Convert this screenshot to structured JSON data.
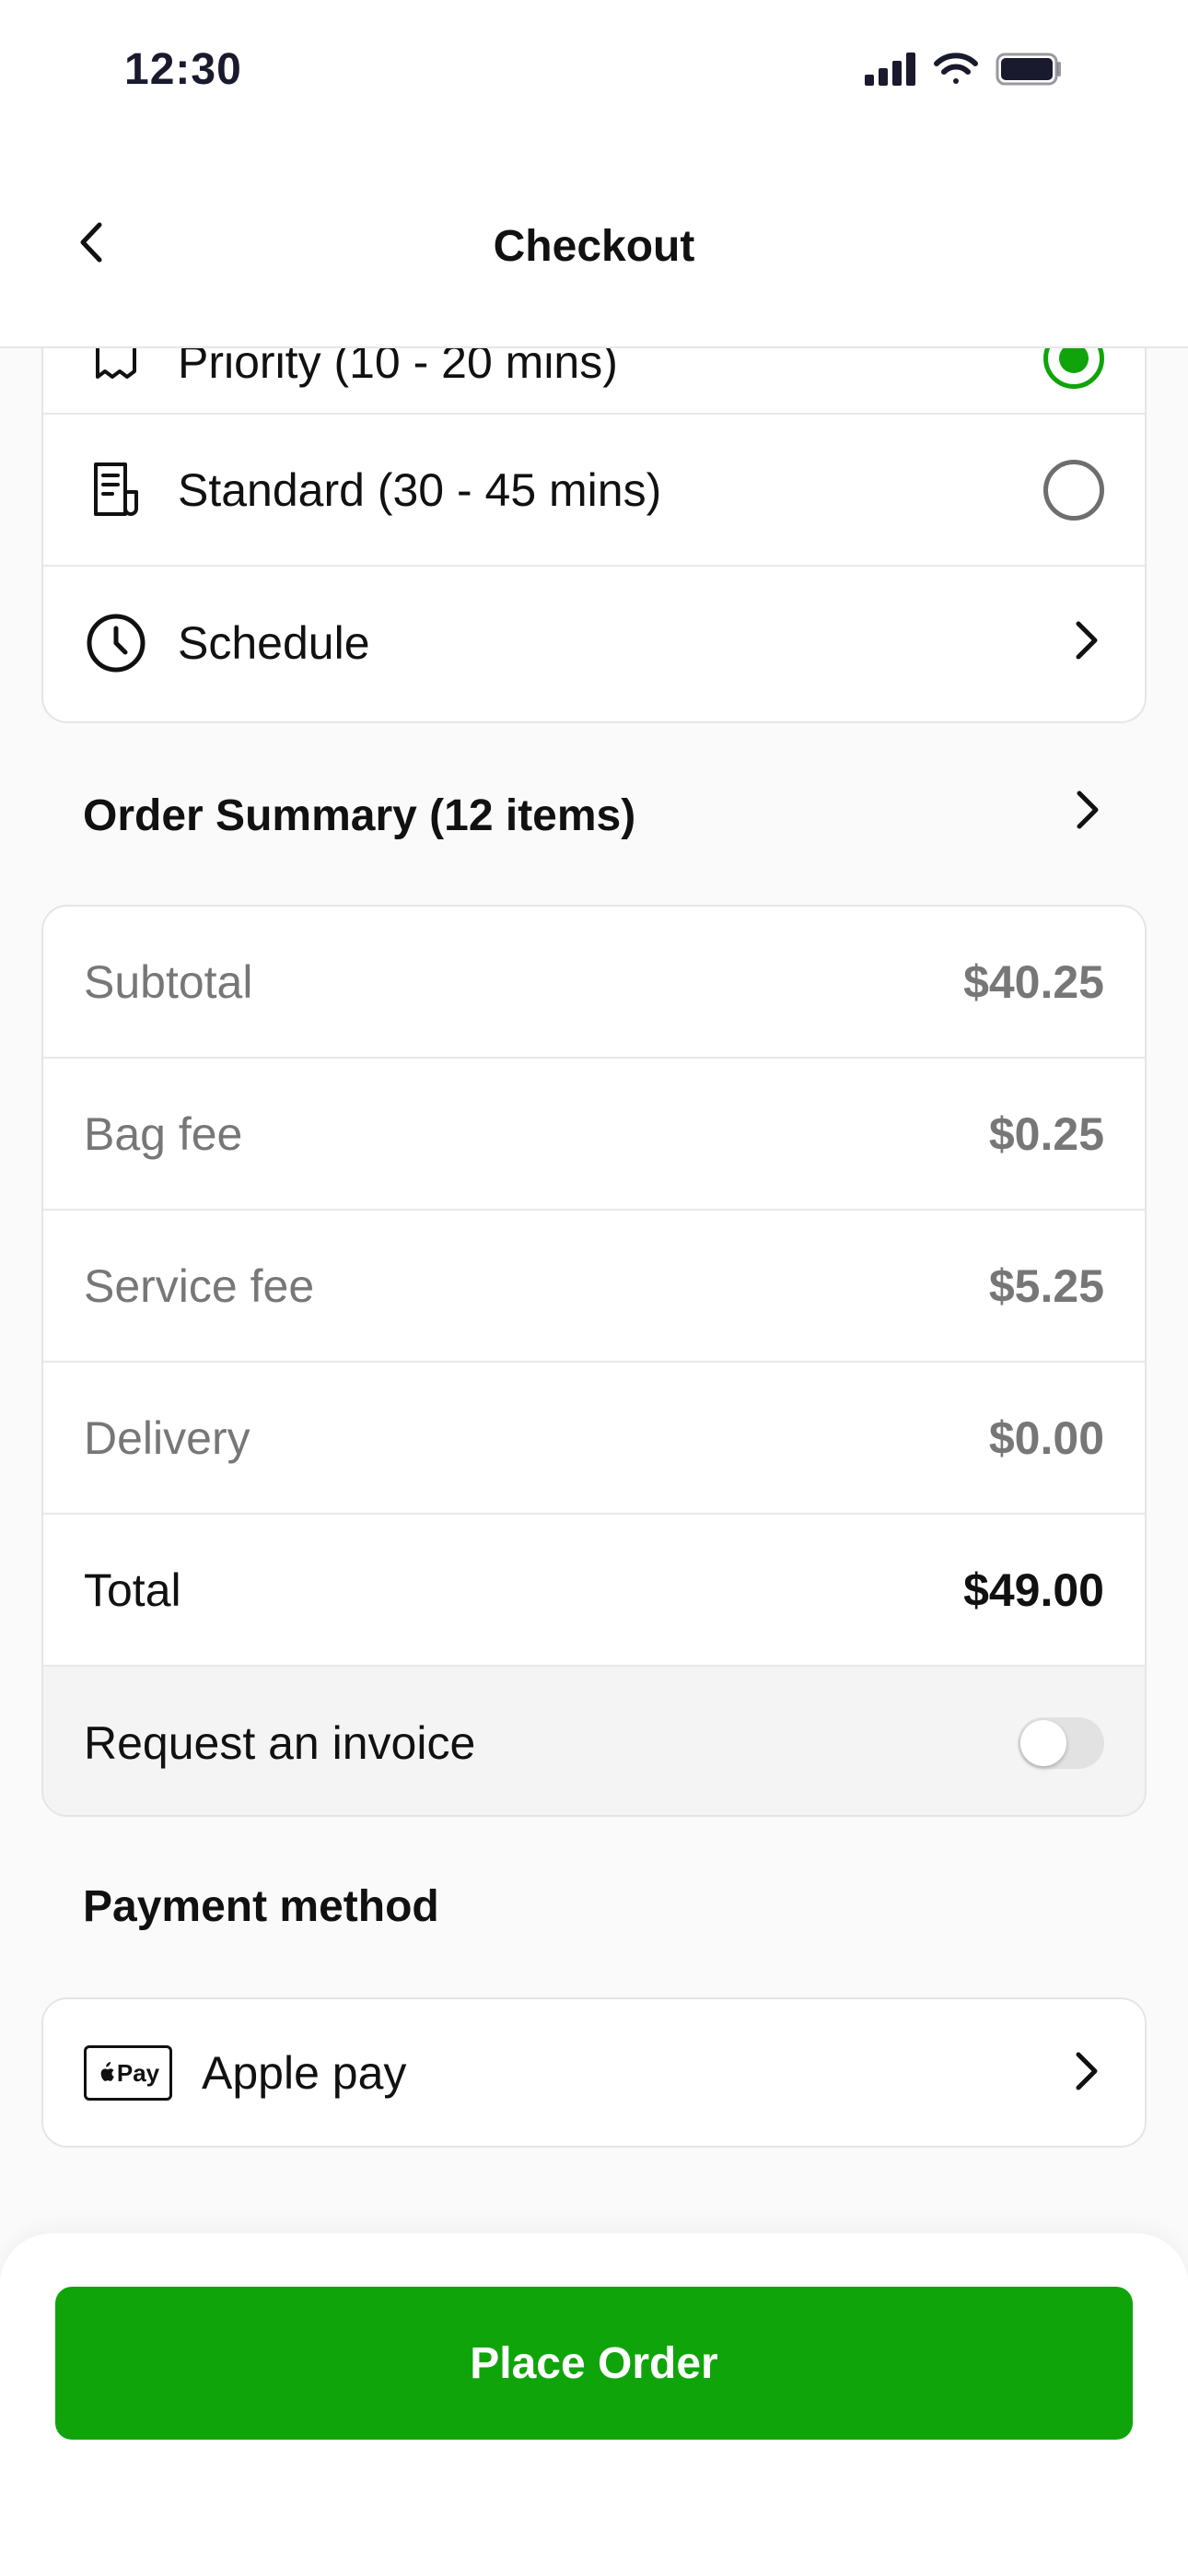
{
  "status_bar": {
    "time": "12:30",
    "icons": [
      "signal-icon",
      "wifi-icon",
      "battery-icon"
    ]
  },
  "header": {
    "title": "Checkout",
    "back_icon": "chevron-left-icon"
  },
  "delivery_options": [
    {
      "label": "Priority (10 - 20 mins)",
      "icon": "receipt-icon",
      "selected": true
    },
    {
      "label": "Standard (30 - 45 mins)",
      "icon": "document-icon",
      "selected": false
    },
    {
      "label": "Schedule",
      "icon": "clock-icon",
      "chevron": true
    }
  ],
  "order_summary": {
    "title": "Order Summary (12 items)",
    "rows": [
      {
        "label": "Subtotal",
        "amount": "$40.25"
      },
      {
        "label": "Bag fee",
        "amount": "$0.25"
      },
      {
        "label": "Service fee",
        "amount": "$5.25"
      },
      {
        "label": "Delivery",
        "amount": "$0.00"
      }
    ],
    "total": {
      "label": "Total",
      "amount": "$49.00"
    },
    "invoice": {
      "label": "Request an invoice",
      "enabled": false
    }
  },
  "payment": {
    "title": "Payment method",
    "method": "Apple pay",
    "badge": "Pay",
    "badge_icon": "apple-logo-icon"
  },
  "footer": {
    "button_label": "Place Order"
  },
  "colors": {
    "accent": "#10a40b",
    "muted_text": "#777777",
    "border": "#e5e5e5"
  }
}
